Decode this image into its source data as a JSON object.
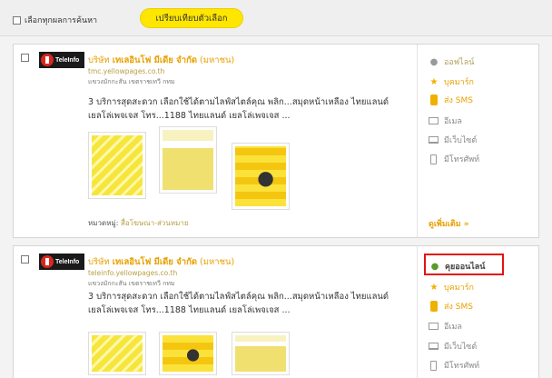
{
  "toolbar": {
    "select_all_label": "เลือกทุกผลการค้นหา",
    "compare_button": "เปรียบเทียบตัวเลือก"
  },
  "results": [
    {
      "company_prefix": "บริษัท",
      "company_highlight": "เทเลอินโฟ มีเดีย จำกัด",
      "company_suffix": "(มหาชน)",
      "url": "tmc.yellowpages.co.th",
      "address": "แขวงมักกะสัน เขตราชเทวี กทม",
      "desc_line1": "3 บริการสุดสะดวก เลือกใช้ได้ตามไลฟ์สไตล์คุณ พลิก...สมุดหน้าเหลือง ไทยแลนด์",
      "desc_line2": "เยลโล่เพจเจส โทร...1188 ไทยแลนด์ เยลโล่เพจเจส ...",
      "category_label": "หมวดหมู่:",
      "category_value": "สื่อโฆษณา-ส่วนหมาย",
      "actions": {
        "primary": "ออฟไลน์",
        "bookmark": "บุคมาร์ก",
        "sms": "ส่ง SMS",
        "email": "อีเมล",
        "website": "มีเว็บไซต์",
        "phone": "มีโทรศัพท์"
      },
      "more": "ดูเพิ่มเติม »"
    },
    {
      "company_prefix": "บริษัท",
      "company_highlight": "เทเลอินโฟ มีเดีย จำกัด",
      "company_suffix": "(มหาชน)",
      "url": "teleinfo.yellowpages.co.th",
      "address": "แขวงมักกะสัน เขตราชเทวี กทม",
      "desc_line1": "3 บริการสุดสะดวก เลือกใช้ได้ตามไลฟ์สไตล์คุณ พลิก...สมุดหน้าเหลือง ไทยแลนด์",
      "desc_line2": "เยลโล่เพจเจส โทร...1188 ไทยแลนด์ เยลโล่เพจเจส ...",
      "actions": {
        "primary": "คุยออนไลน์",
        "bookmark": "บุคมาร์ก",
        "sms": "ส่ง SMS",
        "email": "อีเมล",
        "website": "มีเว็บไซต์",
        "phone": "มีโทรศัพท์"
      }
    }
  ],
  "logo_text": "TeleInfo",
  "colors": {
    "accent": "#fee600",
    "link": "#e8a000",
    "highlight_box": "#e3130f"
  }
}
